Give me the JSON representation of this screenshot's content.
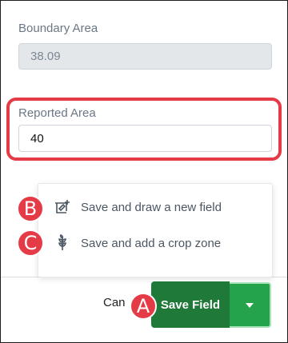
{
  "boundary_area": {
    "label": "Boundary Area",
    "value": "38.09"
  },
  "reported_area": {
    "label": "Reported Area",
    "value": "40"
  },
  "save_menu": {
    "items": [
      {
        "label": "Save and draw a new field",
        "icon": "draw-field-icon"
      },
      {
        "label": "Save and add a crop zone",
        "icon": "crop-zone-icon"
      }
    ]
  },
  "footer": {
    "cancel_label": "Can",
    "save_label": "Save Field",
    "dropdown_icon": "caret-down-icon"
  },
  "badges": [
    "A",
    "B",
    "C"
  ],
  "colors": {
    "highlight": "#e53b46",
    "save_button": "#1f7a3a",
    "dropdown_button": "#25a34b",
    "badge": "#e53b46"
  }
}
